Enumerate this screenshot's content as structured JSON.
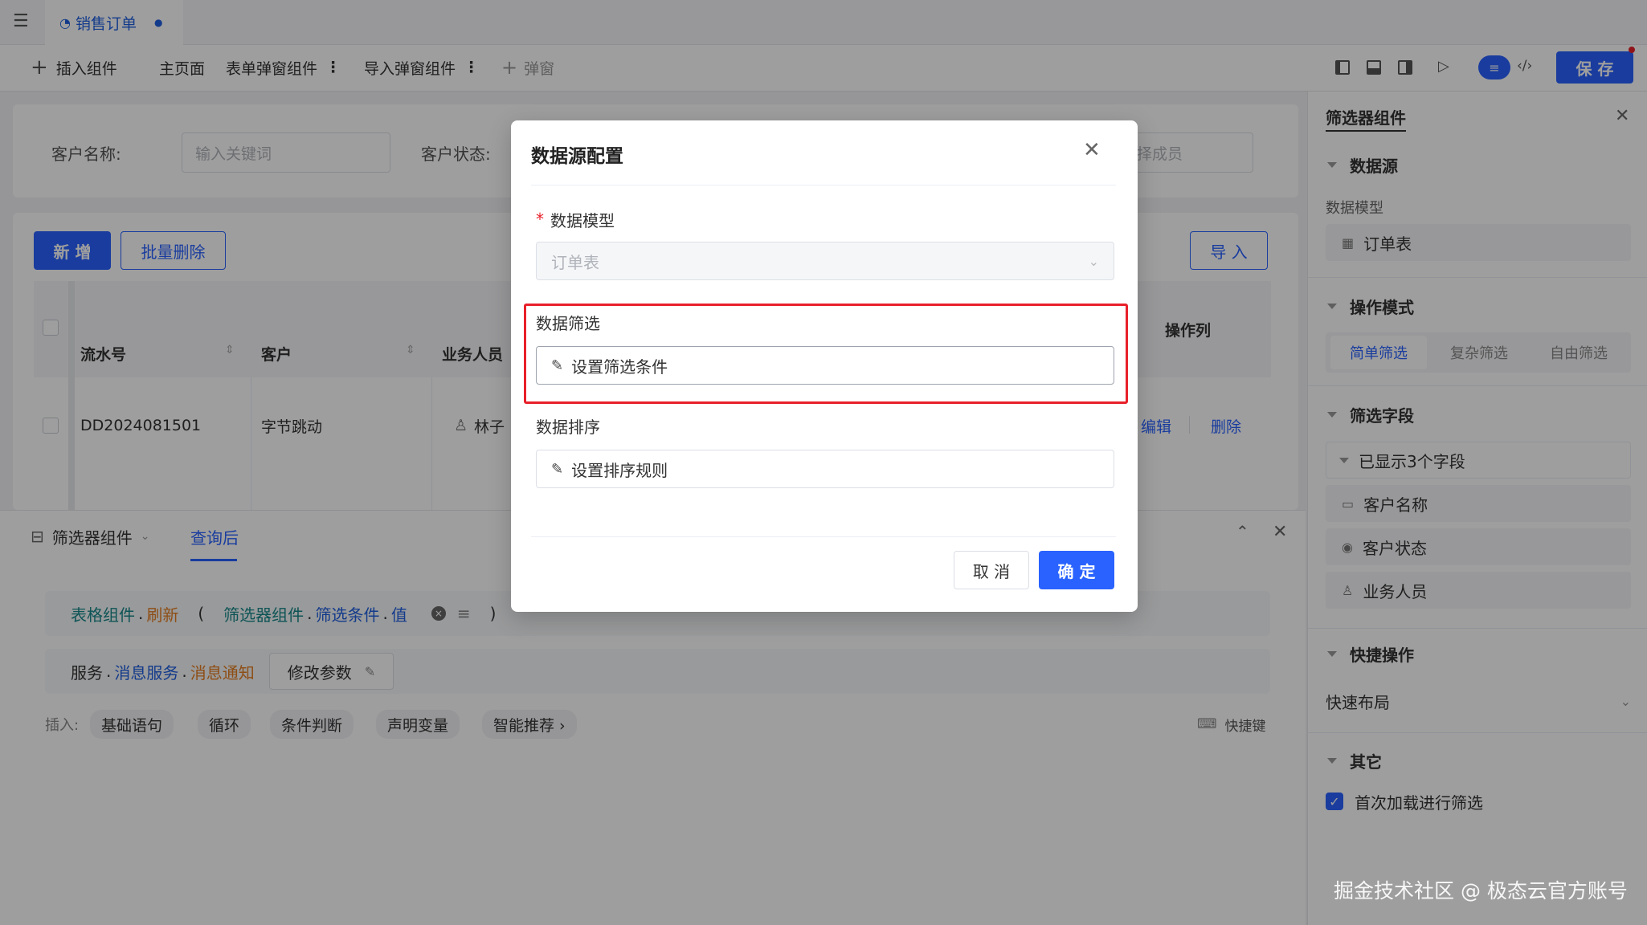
{
  "tab": {
    "title": "销售订单",
    "dot": "●"
  },
  "toolbar": {
    "insert_component": "插入组件",
    "main_page": "主页面",
    "form_popup": "表单弹窗组件",
    "import_popup": "导入弹窗组件",
    "popup": "弹窗",
    "save": "保 存"
  },
  "filter": {
    "customer_name_label": "客户名称:",
    "customer_name_placeholder": "输入关键词",
    "customer_status_label": "客户状态:",
    "member_placeholder": "请选择成员"
  },
  "actions": {
    "add": "新 增",
    "batch_delete": "批量删除",
    "import": "导 入"
  },
  "table": {
    "headers": {
      "serial": "流水号",
      "customer": "客户",
      "salesperson": "业务人员",
      "operations": "操作列"
    },
    "rows": [
      {
        "serial": "DD2024081501",
        "customer": "字节跳动",
        "salesperson": "林子",
        "edit": "编辑",
        "delete": "删除"
      }
    ]
  },
  "bottom": {
    "tab_component": "筛选器组件",
    "tab_after_query": "查询后",
    "line1": {
      "p1": "表格组件",
      "dot1": ".",
      "p2": "刷新",
      "paren_open": "(",
      "p3": "筛选器组件",
      "dot2": ".",
      "p4": "筛选条件",
      "dot3": ".",
      "p5": "值",
      "paren_close": ")"
    },
    "line2": {
      "p1": "服务",
      "dot1": ".",
      "p2": "消息服务",
      "dot2": ".",
      "p3": "消息通知",
      "btn": "修改参数"
    },
    "insert_label": "插入:",
    "chips": [
      "基础语句",
      "循环",
      "条件判断",
      "声明变量",
      "智能推荐 ›"
    ],
    "shortcut": "快捷键"
  },
  "right_panel": {
    "title": "筛选器组件",
    "datasource_section": "数据源",
    "data_model_label": "数据模型",
    "data_model_value": "订单表",
    "operation_mode_section": "操作模式",
    "modes": [
      "简单筛选",
      "复杂筛选",
      "自由筛选"
    ],
    "filter_fields_section": "筛选字段",
    "shown_fields": "已显示3个字段",
    "fields": [
      "客户名称",
      "客户状态",
      "业务人员"
    ],
    "quick_ops_section": "快捷操作",
    "quick_layout": "快速布局",
    "other_section": "其它",
    "first_load_filter": "首次加载进行筛选"
  },
  "modal": {
    "title": "数据源配置",
    "required_mark": "*",
    "data_model_label": "数据模型",
    "data_model_value": "订单表",
    "data_filter_label": "数据筛选",
    "set_filter": "设置筛选条件",
    "data_sort_label": "数据排序",
    "set_sort": "设置排序规则",
    "cancel": "取 消",
    "confirm": "确 定"
  },
  "watermark": "掘金技术社区 @ 极态云官方账号",
  "colors": {
    "primary": "#2962ff",
    "highlight": "#e8202a"
  }
}
